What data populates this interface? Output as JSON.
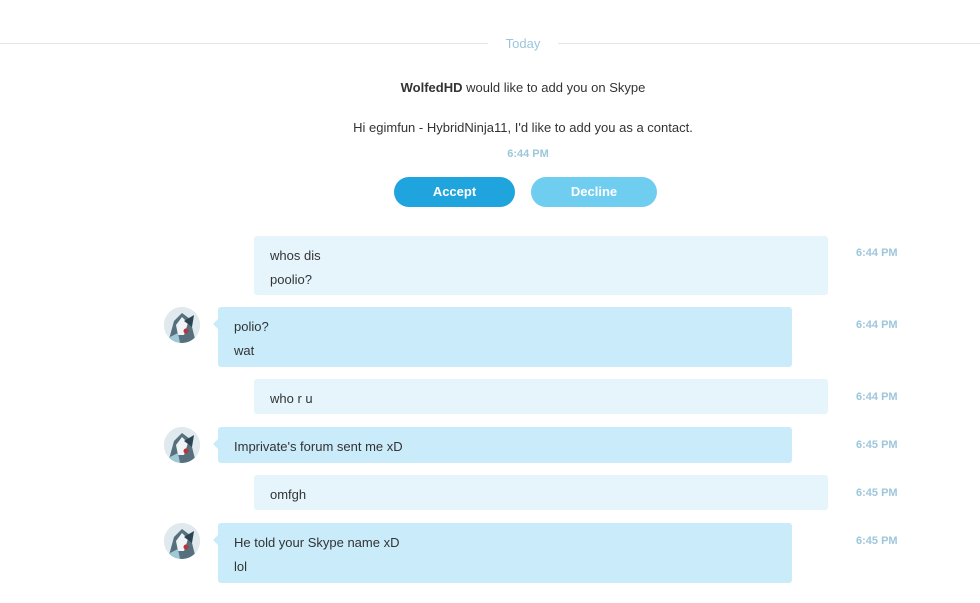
{
  "date_separator": "Today",
  "request": {
    "sender": "WolfedHD",
    "text": " would like to add you on Skype",
    "message": "Hi egimfun - HybridNinja11, I'd like to add you as a contact.",
    "time": "6:44 PM",
    "accept_label": "Accept",
    "decline_label": "Decline"
  },
  "messages": [
    {
      "direction": "out",
      "lines": [
        "whos dis",
        "poolio?"
      ],
      "time": "6:44 PM"
    },
    {
      "direction": "in",
      "lines": [
        "polio?",
        "wat"
      ],
      "time": "6:44 PM"
    },
    {
      "direction": "out",
      "lines": [
        "who r u"
      ],
      "time": "6:44 PM"
    },
    {
      "direction": "in",
      "lines": [
        "Imprivate's forum sent me xD"
      ],
      "time": "6:45 PM"
    },
    {
      "direction": "out",
      "lines": [
        "omfgh"
      ],
      "time": "6:45 PM"
    },
    {
      "direction": "in",
      "lines": [
        "He told your Skype name xD",
        "lol"
      ],
      "time": "6:45 PM"
    }
  ],
  "colors": {
    "accent": "#1fa4dd",
    "decline": "#6fcdf0",
    "bubble_out": "#e6f5fc",
    "bubble_in": "#c9ebfa",
    "timestamp": "#9cc6dc"
  }
}
